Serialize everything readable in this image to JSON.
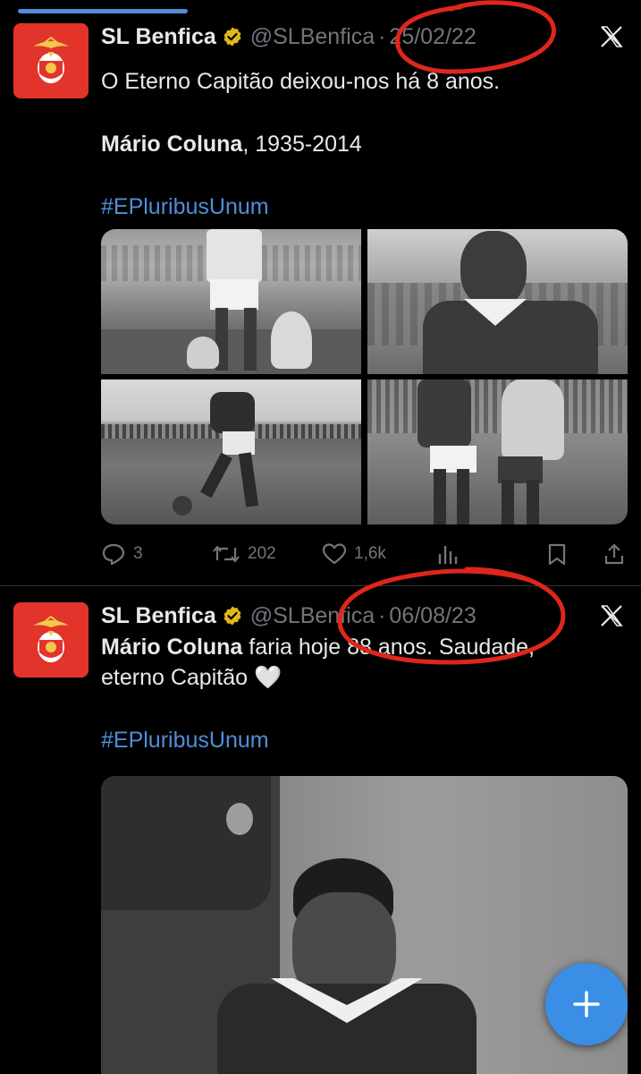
{
  "tweets": [
    {
      "name": "SL Benfica",
      "handle": "@SLBenfica",
      "dot": "·",
      "date": "25/02/22",
      "line1": "O Eterno Capitão deixou-nos há 8 anos.",
      "bold_name": "Mário Coluna",
      "line2_rest": ", 1935-2014",
      "hashtag": "#EPluribusUnum",
      "replies": "3",
      "retweets": "202",
      "likes": "1,6k"
    },
    {
      "name": "SL Benfica",
      "handle": "@SLBenfica",
      "dot": "·",
      "date": "06/08/23",
      "bold_name": "Mário Coluna",
      "line1_rest": " faria hoje 88 anos. Saudade,",
      "line2": "eterno Capitão 🤍",
      "hashtag": "#EPluribusUnum"
    }
  ],
  "icons": {
    "verified": "verified-badge-icon",
    "close": "x-logo-icon",
    "reply": "reply-icon",
    "retweet": "retweet-icon",
    "like": "heart-icon",
    "views": "views-icon",
    "bookmark": "bookmark-icon",
    "share": "share-icon",
    "compose": "plus-icon"
  },
  "colors": {
    "background": "#000000",
    "text": "#e7e9ea",
    "muted": "#71767b",
    "link": "#4e8fd8",
    "verified_gold": "#e2b719",
    "avatar_red": "#e2342b",
    "fab": "#3a8ee6",
    "annotation_red": "#e0261c"
  }
}
